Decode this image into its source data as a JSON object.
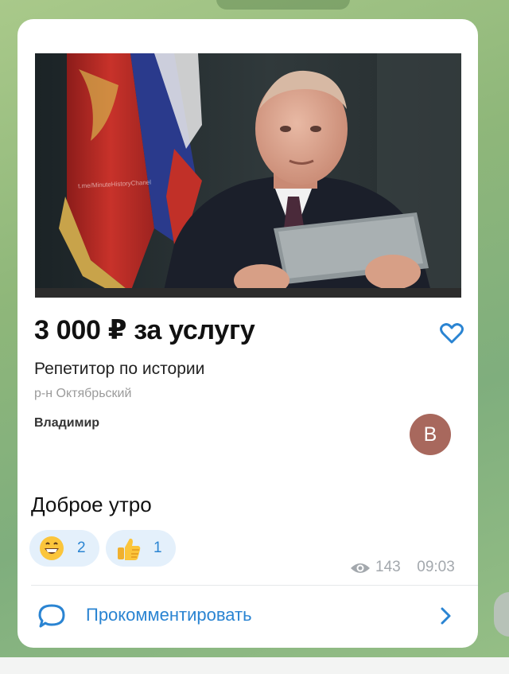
{
  "listing": {
    "price": "3 000 ₽ за услугу",
    "title": "Репетитор по истории",
    "district": "р-н Октябрьский",
    "author": "Владимир",
    "avatar_letter": "В",
    "photo_watermark": "t.me/MinuteHistoryChanel"
  },
  "message": {
    "text": "Доброе утро",
    "views": "143",
    "time": "09:03"
  },
  "reactions": [
    {
      "emoji": "grinning-face",
      "count": "2"
    },
    {
      "emoji": "thumbs-up",
      "count": "1"
    }
  ],
  "footer": {
    "comment_label": "Прокомментировать"
  },
  "colors": {
    "accent": "#2a84d2",
    "avatar": "#a8685d",
    "reaction_bg": "#e4f0fb"
  }
}
